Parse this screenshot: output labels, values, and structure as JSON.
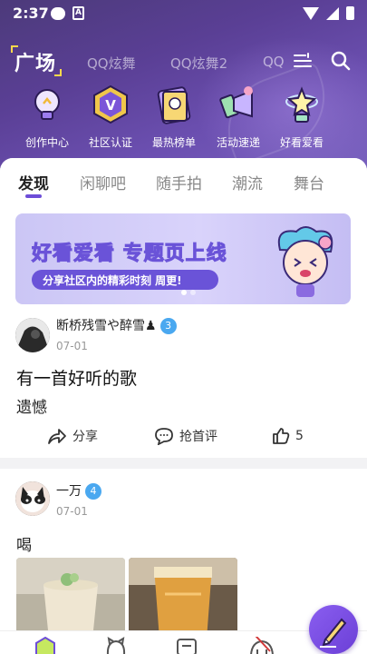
{
  "status_bar": {
    "time": "2:37",
    "notif_badge": "A"
  },
  "header": {
    "brand": "广场",
    "tabs": [
      "QQ炫舞",
      "QQ炫舞2",
      "QQ"
    ],
    "quick_links": [
      {
        "label": "创作中心",
        "icon": "lightbulb-icon"
      },
      {
        "label": "社区认证",
        "icon": "v-badge-icon"
      },
      {
        "label": "最热榜单",
        "icon": "ranking-card-icon"
      },
      {
        "label": "活动速递",
        "icon": "megaphone-icon"
      },
      {
        "label": "好看爱看",
        "icon": "trophy-icon"
      }
    ]
  },
  "feed_tabs": [
    "发现",
    "闲聊吧",
    "随手拍",
    "潮流",
    "舞台"
  ],
  "banner": {
    "title": "好看爱看 专题页上线",
    "subtitle": "分享社区内的精彩时刻 周更!"
  },
  "posts": [
    {
      "author": "断桥残雪や醉雪♟",
      "level": "3",
      "date": "07-01",
      "title": "有一首好听的歌",
      "body": "遗憾",
      "share_label": "分享",
      "comment_label": "抢首评",
      "likes": "5"
    },
    {
      "author": "一万",
      "level": "4",
      "date": "07-01",
      "body": "喝"
    }
  ],
  "bottom_nav": [
    "home-icon",
    "cat-icon",
    "message-icon",
    "profile-icon"
  ],
  "colors": {
    "accent": "#6d4dd8",
    "header": "#5a3f95",
    "level_badge": "#4aa8f0"
  }
}
